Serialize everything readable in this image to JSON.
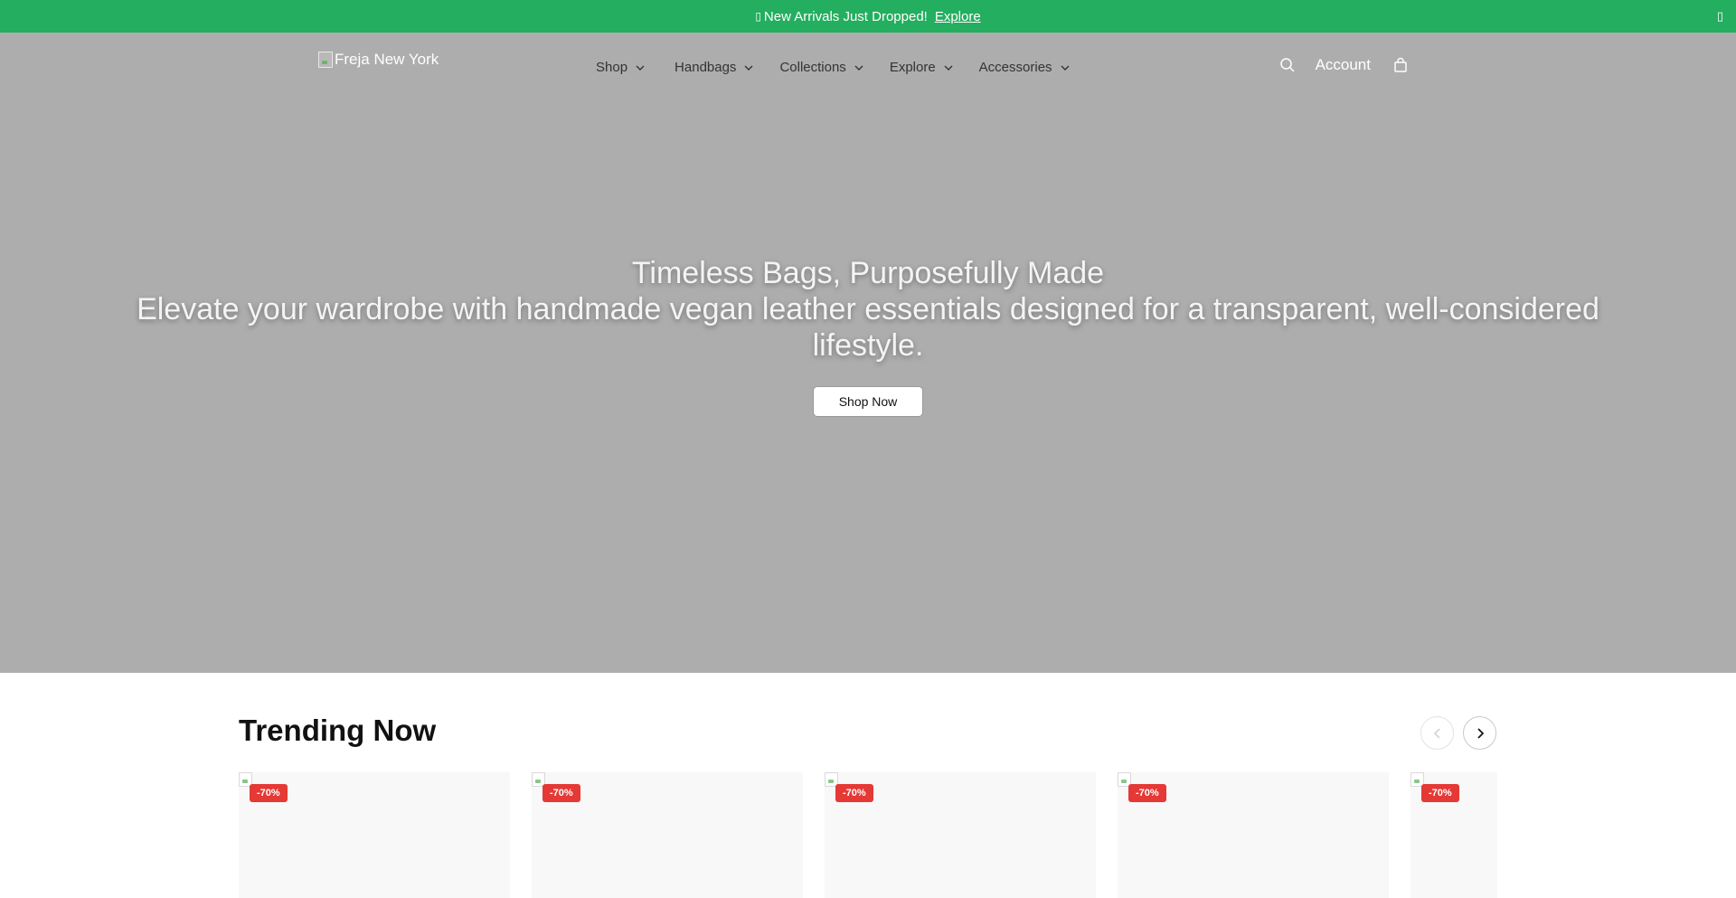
{
  "announcement": {
    "gift_icon": "gift-icon",
    "text": "New Arrivals Just Dropped!",
    "link_label": "Explore",
    "close_icon": "close-icon",
    "background_color": "#24ae5f"
  },
  "header": {
    "logo_alt": "Freja New York",
    "nav": [
      {
        "label": "Shop"
      },
      {
        "label": "Handbags"
      },
      {
        "label": "Collections"
      },
      {
        "label": "Explore"
      },
      {
        "label": "Accessories"
      }
    ],
    "account_label": "Account",
    "icons": {
      "search": "search-icon",
      "bag": "shopping-bag-icon",
      "chevron": "chevron-down-icon"
    }
  },
  "hero": {
    "title": "Timeless Bags, Purposefully Made",
    "subtitle": "Elevate your wardrobe with handmade vegan leather essentials designed for a transparent, well-considered lifestyle.",
    "cta_label": "Shop Now",
    "background_color": "#adadad"
  },
  "trending": {
    "title": "Trending Now",
    "prev_icon": "chevron-left-icon",
    "next_icon": "chevron-right-icon",
    "products": [
      {
        "badge": "-70%"
      },
      {
        "badge": "-70%"
      },
      {
        "badge": "-70%"
      },
      {
        "badge": "-70%"
      },
      {
        "badge": "-70%"
      }
    ],
    "badge_color": "#e53935"
  }
}
